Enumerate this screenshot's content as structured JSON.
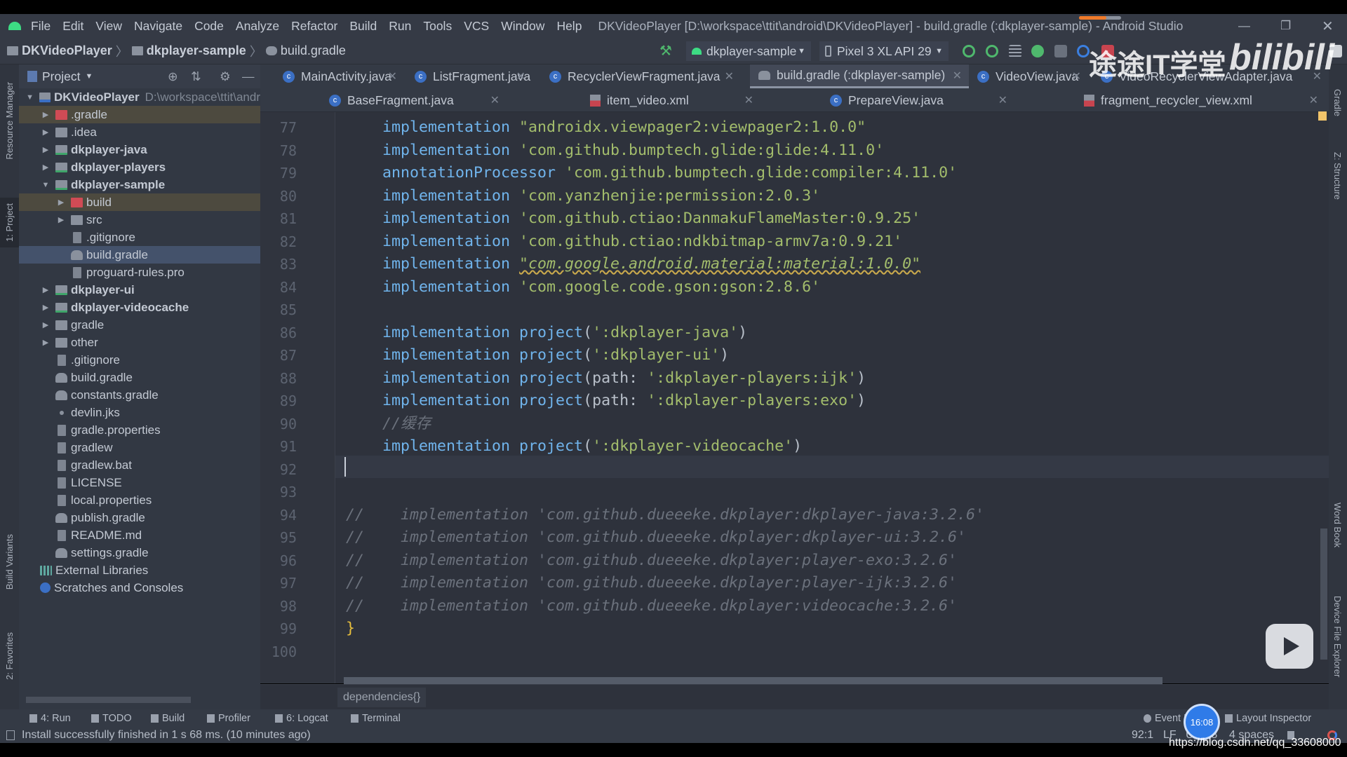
{
  "menubar": {
    "items": [
      "File",
      "Edit",
      "View",
      "Navigate",
      "Code",
      "Analyze",
      "Refactor",
      "Build",
      "Run",
      "Tools",
      "VCS",
      "Window",
      "Help"
    ],
    "window_title": "DKVideoPlayer [D:\\workspace\\ttit\\android\\DKVideoPlayer] - build.gradle (:dkplayer-sample) - Android Studio"
  },
  "breadcrumb": [
    "DKVideoPlayer",
    "dkplayer-sample",
    "build.gradle"
  ],
  "toolbar": {
    "run_config": "dkplayer-sample",
    "device": "Pixel 3 XL API 29"
  },
  "left_stripe": [
    "Resource Manager",
    "1: Project",
    "Build Variants",
    "2: Favorites"
  ],
  "right_stripe": [
    "Gradle",
    "Z: Structure",
    "Word Book",
    "Device File Explorer"
  ],
  "project": {
    "title": "Project",
    "root": {
      "name": "DKVideoPlayer",
      "path": "D:\\workspace\\ttit\\andr"
    },
    "items": [
      {
        "label": ".gradle",
        "level": 1,
        "arrow": "right",
        "icon": "folder-red",
        "bold": false,
        "state": "excluded"
      },
      {
        "label": ".idea",
        "level": 1,
        "arrow": "right",
        "icon": "folder",
        "bold": false
      },
      {
        "label": "dkplayer-java",
        "level": 1,
        "arrow": "right",
        "icon": "module",
        "bold": true
      },
      {
        "label": "dkplayer-players",
        "level": 1,
        "arrow": "right",
        "icon": "module",
        "bold": true
      },
      {
        "label": "dkplayer-sample",
        "level": 1,
        "arrow": "down",
        "icon": "module",
        "bold": true
      },
      {
        "label": "build",
        "level": 2,
        "arrow": "right",
        "icon": "folder-red",
        "bold": false,
        "state": "excluded"
      },
      {
        "label": "src",
        "level": 2,
        "arrow": "right",
        "icon": "folder",
        "bold": false
      },
      {
        "label": ".gitignore",
        "level": 2,
        "icon": "file",
        "bold": false
      },
      {
        "label": "build.gradle",
        "level": 2,
        "icon": "gradle",
        "bold": false,
        "state": "selected"
      },
      {
        "label": "proguard-rules.pro",
        "level": 2,
        "icon": "file",
        "bold": false
      },
      {
        "label": "dkplayer-ui",
        "level": 1,
        "arrow": "right",
        "icon": "module",
        "bold": true
      },
      {
        "label": "dkplayer-videocache",
        "level": 1,
        "arrow": "right",
        "icon": "module",
        "bold": true
      },
      {
        "label": "gradle",
        "level": 1,
        "arrow": "right",
        "icon": "folder",
        "bold": false
      },
      {
        "label": "other",
        "level": 1,
        "arrow": "right",
        "icon": "folder",
        "bold": false
      },
      {
        "label": ".gitignore",
        "level": 1,
        "icon": "file",
        "bold": false
      },
      {
        "label": "build.gradle",
        "level": 1,
        "icon": "gradle",
        "bold": false
      },
      {
        "label": "constants.gradle",
        "level": 1,
        "icon": "gradle",
        "bold": false
      },
      {
        "label": "devlin.jks",
        "level": 1,
        "icon": "dot",
        "bold": false
      },
      {
        "label": "gradle.properties",
        "level": 1,
        "icon": "file",
        "bold": false
      },
      {
        "label": "gradlew",
        "level": 1,
        "icon": "file",
        "bold": false
      },
      {
        "label": "gradlew.bat",
        "level": 1,
        "icon": "file",
        "bold": false
      },
      {
        "label": "LICENSE",
        "level": 1,
        "icon": "file",
        "bold": false
      },
      {
        "label": "local.properties",
        "level": 1,
        "icon": "file",
        "bold": false
      },
      {
        "label": "publish.gradle",
        "level": 1,
        "icon": "gradle",
        "bold": false
      },
      {
        "label": "README.md",
        "level": 1,
        "icon": "file",
        "bold": false
      },
      {
        "label": "settings.gradle",
        "level": 1,
        "icon": "gradle",
        "bold": false
      },
      {
        "label": "External Libraries",
        "level": 0,
        "icon": "libraries",
        "bold": false
      },
      {
        "label": "Scratches and Consoles",
        "level": 0,
        "icon": "scratches",
        "bold": false
      }
    ]
  },
  "tabs_row1": [
    {
      "label": "MainActivity.java",
      "icon": "class"
    },
    {
      "label": "ListFragment.java",
      "icon": "class"
    },
    {
      "label": "RecyclerViewFragment.java",
      "icon": "class"
    },
    {
      "label": "build.gradle (:dkplayer-sample)",
      "icon": "gradle",
      "active": true
    },
    {
      "label": "VideoView.java",
      "icon": "class"
    },
    {
      "label": "VideoRecyclerViewAdapter.java",
      "icon": "class"
    }
  ],
  "tabs_row2": [
    {
      "label": "BaseFragment.java",
      "icon": "class"
    },
    {
      "label": "item_video.xml",
      "icon": "xml"
    },
    {
      "label": "PrepareView.java",
      "icon": "class"
    },
    {
      "label": "fragment_recycler_view.xml",
      "icon": "xml"
    }
  ],
  "editor": {
    "current_line": 92,
    "lines": [
      {
        "n": "77",
        "t": [
          [
            "    ",
            ""
          ],
          [
            "implementation",
            "kw"
          ],
          [
            " ",
            ""
          ],
          [
            "\"androidx.viewpager2:viewpager2:1.0.0\"",
            "str"
          ]
        ]
      },
      {
        "n": "78",
        "t": [
          [
            "    ",
            ""
          ],
          [
            "implementation",
            "kw"
          ],
          [
            " ",
            ""
          ],
          [
            "'com.github.bumptech.glide:glide:4.11.0'",
            "str"
          ]
        ]
      },
      {
        "n": "79",
        "t": [
          [
            "    ",
            ""
          ],
          [
            "annotationProcessor",
            "kw"
          ],
          [
            " ",
            ""
          ],
          [
            "'com.github.bumptech.glide:compiler:4.11.0'",
            "str"
          ]
        ]
      },
      {
        "n": "80",
        "t": [
          [
            "    ",
            ""
          ],
          [
            "implementation",
            "kw"
          ],
          [
            " ",
            ""
          ],
          [
            "'com.yanzhenjie:permission:2.0.3'",
            "str"
          ]
        ]
      },
      {
        "n": "81",
        "t": [
          [
            "    ",
            ""
          ],
          [
            "implementation",
            "kw"
          ],
          [
            " ",
            ""
          ],
          [
            "'com.github.ctiao:DanmakuFlameMaster:0.9.25'",
            "str"
          ]
        ]
      },
      {
        "n": "82",
        "t": [
          [
            "    ",
            ""
          ],
          [
            "implementation",
            "kw"
          ],
          [
            " ",
            ""
          ],
          [
            "'com.github.ctiao:ndkbitmap-armv7a:0.9.21'",
            "str"
          ]
        ]
      },
      {
        "n": "83",
        "t": [
          [
            "    ",
            ""
          ],
          [
            "implementation",
            "kw"
          ],
          [
            " ",
            ""
          ],
          [
            "\"com.google.android.material:material:1.0.0\"",
            "stri"
          ]
        ]
      },
      {
        "n": "84",
        "t": [
          [
            "    ",
            ""
          ],
          [
            "implementation",
            "kw"
          ],
          [
            " ",
            ""
          ],
          [
            "'com.google.code.gson:gson:2.8.6'",
            "str"
          ]
        ]
      },
      {
        "n": "85",
        "t": []
      },
      {
        "n": "86",
        "t": [
          [
            "    ",
            ""
          ],
          [
            "implementation",
            "kw"
          ],
          [
            " ",
            ""
          ],
          [
            "project",
            "kw"
          ],
          [
            "(",
            ""
          ],
          [
            "':dkplayer-java'",
            "str"
          ],
          [
            ")",
            ""
          ]
        ]
      },
      {
        "n": "87",
        "t": [
          [
            "    ",
            ""
          ],
          [
            "implementation",
            "kw"
          ],
          [
            " ",
            ""
          ],
          [
            "project",
            "kw"
          ],
          [
            "(",
            ""
          ],
          [
            "':dkplayer-ui'",
            "str"
          ],
          [
            ")",
            ""
          ]
        ]
      },
      {
        "n": "88",
        "t": [
          [
            "    ",
            ""
          ],
          [
            "implementation",
            "kw"
          ],
          [
            " ",
            ""
          ],
          [
            "project",
            "kw"
          ],
          [
            "(path: ",
            ""
          ],
          [
            "':dkplayer-players:ijk'",
            "str"
          ],
          [
            ")",
            ""
          ]
        ]
      },
      {
        "n": "89",
        "t": [
          [
            "    ",
            ""
          ],
          [
            "implementation",
            "kw"
          ],
          [
            " ",
            ""
          ],
          [
            "project",
            "kw"
          ],
          [
            "(path: ",
            ""
          ],
          [
            "':dkplayer-players:exo'",
            "str"
          ],
          [
            ")",
            ""
          ]
        ]
      },
      {
        "n": "90",
        "t": [
          [
            "    ",
            ""
          ],
          [
            "//缓存",
            "cm"
          ]
        ]
      },
      {
        "n": "91",
        "t": [
          [
            "    ",
            ""
          ],
          [
            "implementation",
            "kw"
          ],
          [
            " ",
            ""
          ],
          [
            "project",
            "kw"
          ],
          [
            "(",
            ""
          ],
          [
            "':dkplayer-videocache'",
            "str"
          ],
          [
            ")",
            ""
          ]
        ]
      },
      {
        "n": "92",
        "t": []
      },
      {
        "n": "93",
        "t": []
      },
      {
        "n": "94",
        "t": [
          [
            "//    implementation 'com.github.dueeeke.dkplayer:dkplayer-java:3.2.6'",
            "cm"
          ]
        ]
      },
      {
        "n": "95",
        "t": [
          [
            "//    implementation 'com.github.dueeeke.dkplayer:dkplayer-ui:3.2.6'",
            "cm"
          ]
        ]
      },
      {
        "n": "96",
        "t": [
          [
            "//    implementation 'com.github.dueeeke.dkplayer:player-exo:3.2.6'",
            "cm"
          ]
        ]
      },
      {
        "n": "97",
        "t": [
          [
            "//    implementation 'com.github.dueeeke.dkplayer:player-ijk:3.2.6'",
            "cm"
          ]
        ]
      },
      {
        "n": "98",
        "t": [
          [
            "//    implementation 'com.github.dueeeke.dkplayer:videocache:3.2.6'",
            "cm"
          ]
        ]
      },
      {
        "n": "99",
        "t": [
          [
            "}",
            "brace"
          ]
        ]
      },
      {
        "n": "100",
        "t": []
      }
    ],
    "breadcrumb": "dependencies{}"
  },
  "tool_windows": {
    "left": [
      "4: Run",
      "TODO",
      "Build",
      "Profiler",
      "6: Logcat",
      "Terminal"
    ],
    "right": [
      "Event Log",
      "Layout Inspector"
    ]
  },
  "status": {
    "message": "Install successfully finished in 1 s 68 ms. (10 minutes ago)",
    "position": "92:1",
    "line_sep": "LF",
    "encoding": "UTF-8",
    "indent": "4 spaces"
  },
  "overlays": {
    "watermark_cn": "途途IT学堂",
    "watermark_logo": "bilibili",
    "clock": "16:08",
    "url": "https://blog.csdn.net/qq_33608000",
    "build_progress": 0.65
  },
  "colors": {
    "keyword": "#70b4ec",
    "string": "#a3bd6c",
    "comment": "#6b717c",
    "brace": "#e8bf3c",
    "editor_bg": "#2e323c",
    "selection": "#44526b"
  }
}
